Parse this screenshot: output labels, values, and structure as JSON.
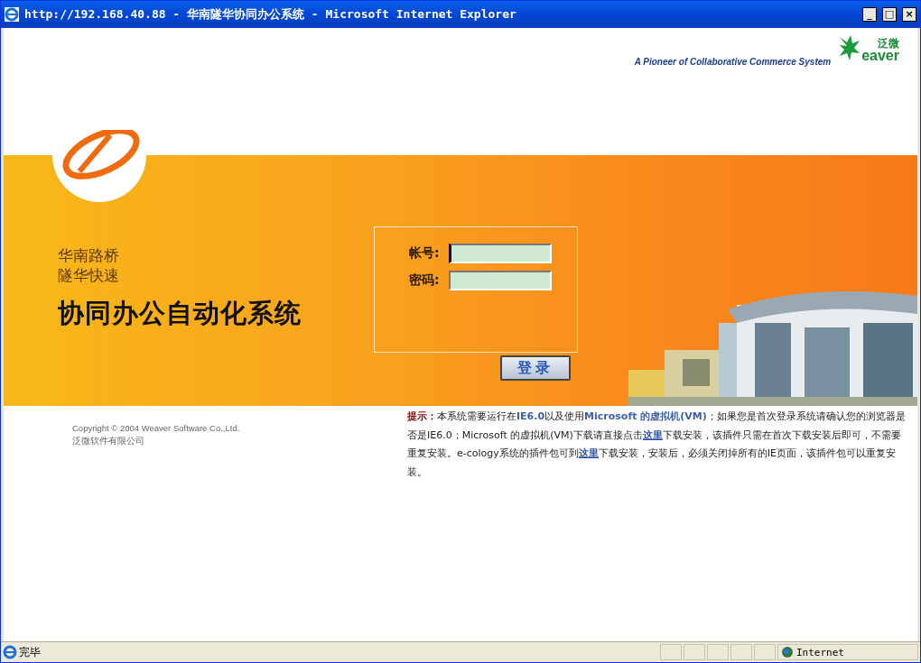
{
  "window": {
    "title": "http://192.168.40.88 - 华南隧华协同办公系统 - Microsoft Internet Explorer",
    "controls": [
      "_",
      "□",
      "×"
    ]
  },
  "header": {
    "slogan": "A Pioneer of Collaborative Commerce System",
    "brand_cn": "泛微",
    "brand_en": "eaver"
  },
  "banner": {
    "subtitle_lines": [
      "华南路桥",
      "隧华快速"
    ],
    "title": "协同办公自动化系统"
  },
  "login": {
    "fields": [
      {
        "label": "帐号:",
        "focused": true
      },
      {
        "label": "密码:",
        "focused": false
      }
    ],
    "button": "登录"
  },
  "footer": {
    "copyright": [
      "Copyright © 2004 Weaver Software Co.,Ltd.",
      "泛微软件有限公司"
    ]
  },
  "hint": [
    {
      "kind": "label",
      "text": "提示："
    },
    {
      "kind": "text",
      "text": "本系统需要运行在"
    },
    {
      "kind": "strong",
      "text": "IE6.0"
    },
    {
      "kind": "text",
      "text": "以及使用"
    },
    {
      "kind": "strong",
      "text": "Microsoft 的虚拟机(VM)"
    },
    {
      "kind": "text",
      "text": "；如果您是首次登录系统请确认您的浏览器是否是IE6.0；Microsoft 的虚拟机(VM)下载请直接点击"
    },
    {
      "kind": "link",
      "text": "这里"
    },
    {
      "kind": "text",
      "text": "下载安装，该插件只需在首次下载安装后即可，不需要重复安装。e-cology系统的插件包可到"
    },
    {
      "kind": "link",
      "text": "这里"
    },
    {
      "kind": "text",
      "text": "下载安装，安装后，必须关闭掉所有的IE页面，该插件包可以重复安装。"
    }
  ],
  "status_bar": {
    "status": "完毕",
    "zone": "Internet"
  }
}
